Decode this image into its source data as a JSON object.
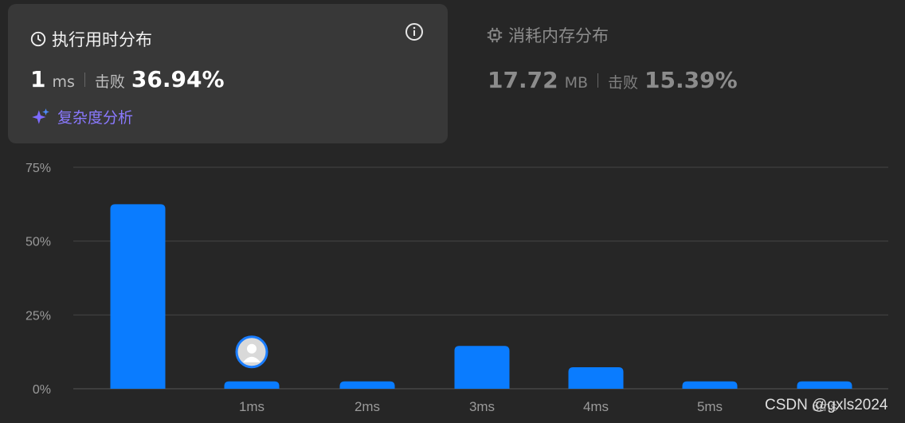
{
  "runtime": {
    "title": "执行用时分布",
    "value": "1",
    "unit": "ms",
    "beat_label": "击败",
    "beat_percent": "36.94%",
    "analysis_label": "复杂度分析"
  },
  "memory": {
    "title": "消耗内存分布",
    "value": "17.72",
    "unit": "MB",
    "beat_label": "击败",
    "beat_percent": "15.39%"
  },
  "watermark": "CSDN @gxls2024",
  "colors": {
    "bar": "#0a7cff",
    "card": "#383838",
    "accent": "#8a79ff"
  },
  "chart_data": {
    "type": "bar",
    "categories": [
      "",
      "1ms",
      "2ms",
      "3ms",
      "4ms",
      "5ms",
      "6ms"
    ],
    "values": [
      62.5,
      2.5,
      2.5,
      14.5,
      7.3,
      2.5,
      2.5
    ],
    "yticks": [
      "0%",
      "25%",
      "50%",
      "75%"
    ],
    "ytick_values": [
      0,
      25,
      50,
      75
    ],
    "ylim": [
      0,
      75
    ],
    "highlight_category": "1ms",
    "grid": true
  }
}
